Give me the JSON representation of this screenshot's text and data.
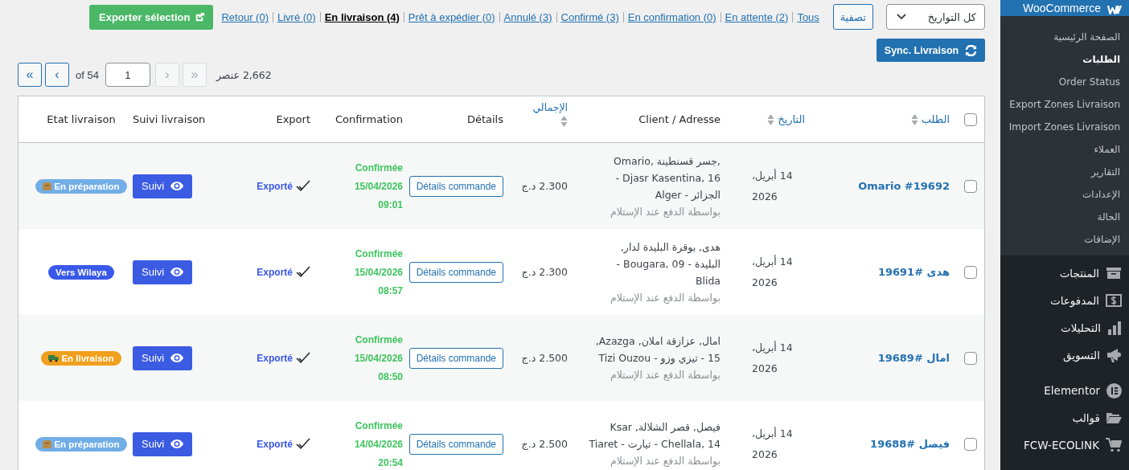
{
  "toolbar": {
    "export_button": "Exporter sélection",
    "status_links": [
      {
        "label": "Tous",
        "selected": false
      },
      {
        "label": "En attente (2)",
        "selected": false
      },
      {
        "label": "En confirmation (0)",
        "selected": false
      },
      {
        "label": "Confirmé (3)",
        "selected": false
      },
      {
        "label": "Annulé (3)",
        "selected": false
      },
      {
        "label": "Prêt à expédier (0)",
        "selected": false
      },
      {
        "label": "En livraison (4)",
        "selected": true
      },
      {
        "label": "Livré (0)",
        "selected": false
      },
      {
        "label": "Retour (0)",
        "selected": false
      }
    ],
    "filter_button": "تصفية",
    "date_select": {
      "value": "كل التواريخ"
    },
    "sync_button": "Sync. Livraison"
  },
  "pagination": {
    "first": "«",
    "prev": "‹",
    "of_total": "of 54",
    "page": "1",
    "next": {
      "label": "›",
      "disabled": true
    },
    "last": {
      "label": "»",
      "disabled": true
    },
    "items_count": "2,662 عنصر"
  },
  "table": {
    "select_all": false,
    "columns": [
      {
        "label": "الطلب",
        "sortable": true
      },
      {
        "label": "التاريخ",
        "sortable": true
      },
      {
        "label": "Client / Adresse",
        "sortable": false
      },
      {
        "label": "الإجمالي",
        "sortable": true
      },
      {
        "label": "Détails",
        "sortable": false
      },
      {
        "label": "Confirmation",
        "sortable": false
      },
      {
        "label": "Export",
        "sortable": false
      },
      {
        "label": "Suivi livraison",
        "sortable": false
      },
      {
        "label": "Etat livraison",
        "sortable": false
      }
    ],
    "rows": [
      {
        "selected": false,
        "order": "Omario #19692",
        "date": "14 أبريل، 2026",
        "address_lines": [
          "Omario, جسر قسنطينة,",
          "- Djasr Kasentina, 16",
          "الجزائر - Alger"
        ],
        "payment": "بواسطة الدفع عند الإستلام",
        "total": "2.300 د.ج",
        "details_button": "Détails commande",
        "confirmation": {
          "status": "Confirmée",
          "date": "15/04/2026",
          "time": "09:01"
        },
        "export": "Exporté",
        "track_button": "Suivi",
        "delivery_state": {
          "label": "En préparation",
          "kind": "preparation",
          "color": "#72aee6"
        }
      },
      {
        "selected": false,
        "order": "هدى #19691",
        "date": "14 أبريل، 2026",
        "address_lines": [
          "هدى, بوقرة البليدة لدار,",
          "- Bougara, 09 - البليدة",
          "Blida"
        ],
        "payment": "بواسطة الدفع عند الإستلام",
        "total": "2.300 د.ج",
        "details_button": "Détails commande",
        "confirmation": {
          "status": "Confirmée",
          "date": "15/04/2026",
          "time": "08:57"
        },
        "export": "Exporté",
        "track_button": "Suivi",
        "delivery_state": {
          "label": "Vers Wilaya",
          "kind": "wilaya",
          "color": "#3858e9"
        }
      },
      {
        "selected": false,
        "order": "امال #19689",
        "date": "14 أبريل، 2026",
        "address_lines": [
          "امال, عزازقة املان, Azazga,",
          "15 - تيزي وزو - Tizi Ouzou"
        ],
        "payment": "بواسطة الدفع عند الإستلام",
        "total": "2.500 د.ج",
        "details_button": "Détails commande",
        "confirmation": {
          "status": "Confirmée",
          "date": "15/04/2026",
          "time": "08:50"
        },
        "export": "Exporté",
        "track_button": "Suivi",
        "delivery_state": {
          "label": "En livraison",
          "kind": "delivery",
          "color": "#f0a01e"
        }
      },
      {
        "selected": false,
        "order": "فيصل #19688",
        "date": "14 أبريل، 2026",
        "address_lines": [
          "فيصل, قصر الشلالة, Ksar",
          "Tiaret - تيارت - Chellala, 14"
        ],
        "payment": "بواسطة الدفع عند الإستلام",
        "total": "2.500 د.ج",
        "details_button": "Détails commande",
        "confirmation": {
          "status": "Confirmée",
          "date": "14/04/2026",
          "time": "20:54"
        },
        "export": "Exporté",
        "track_button": "Suivi",
        "delivery_state": {
          "label": "En préparation",
          "kind": "preparation",
          "color": "#72aee6"
        }
      }
    ]
  },
  "sidebar": {
    "parent": {
      "label": "WooCommerce",
      "selected": true
    },
    "submenu": [
      {
        "label": "الصفحة الرئيسية",
        "selected": false
      },
      {
        "label": "الطلبات",
        "selected": true
      },
      {
        "label": "Order Status",
        "selected": false
      },
      {
        "label": "Export Zones Livraison",
        "selected": false
      },
      {
        "label": "Import Zones Livraison",
        "selected": false
      },
      {
        "label": "العملاء",
        "selected": false
      },
      {
        "label": "التقارير",
        "selected": false
      },
      {
        "label": "الإعدادات",
        "selected": false
      },
      {
        "label": "الحالة",
        "selected": false
      },
      {
        "label": "الإضافات",
        "selected": false
      }
    ],
    "menu": [
      {
        "label": "المنتجات",
        "selected": false
      },
      {
        "label": "المدفوعات",
        "selected": false
      },
      {
        "label": "التحليلات",
        "selected": false
      },
      {
        "label": "التسويق",
        "selected": false
      },
      {
        "label": "Elementor",
        "selected": false
      },
      {
        "label": "قوالب",
        "selected": false
      },
      {
        "label": "FCW-ECOLINK",
        "selected": false
      }
    ]
  }
}
